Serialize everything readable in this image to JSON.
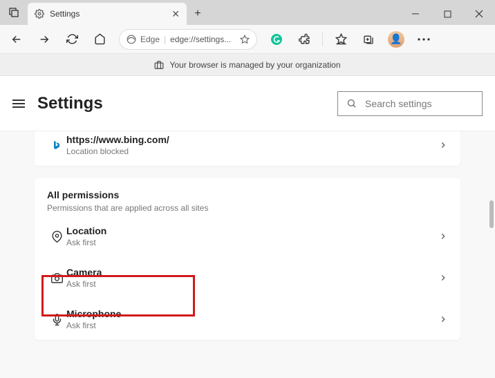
{
  "tab": {
    "title": "Settings"
  },
  "address": {
    "browser": "Edge",
    "url": "edge://settings..."
  },
  "infobar": {
    "text": "Your browser is managed by your organization"
  },
  "header": {
    "title": "Settings",
    "search_placeholder": "Search settings"
  },
  "recent": {
    "url": "https://www.bing.com/",
    "status": "Location blocked"
  },
  "all_permissions": {
    "title": "All permissions",
    "sub": "Permissions that are applied across all sites",
    "items": [
      {
        "name": "Location",
        "status": "Ask first"
      },
      {
        "name": "Camera",
        "status": "Ask first"
      },
      {
        "name": "Microphone",
        "status": "Ask first"
      }
    ]
  }
}
